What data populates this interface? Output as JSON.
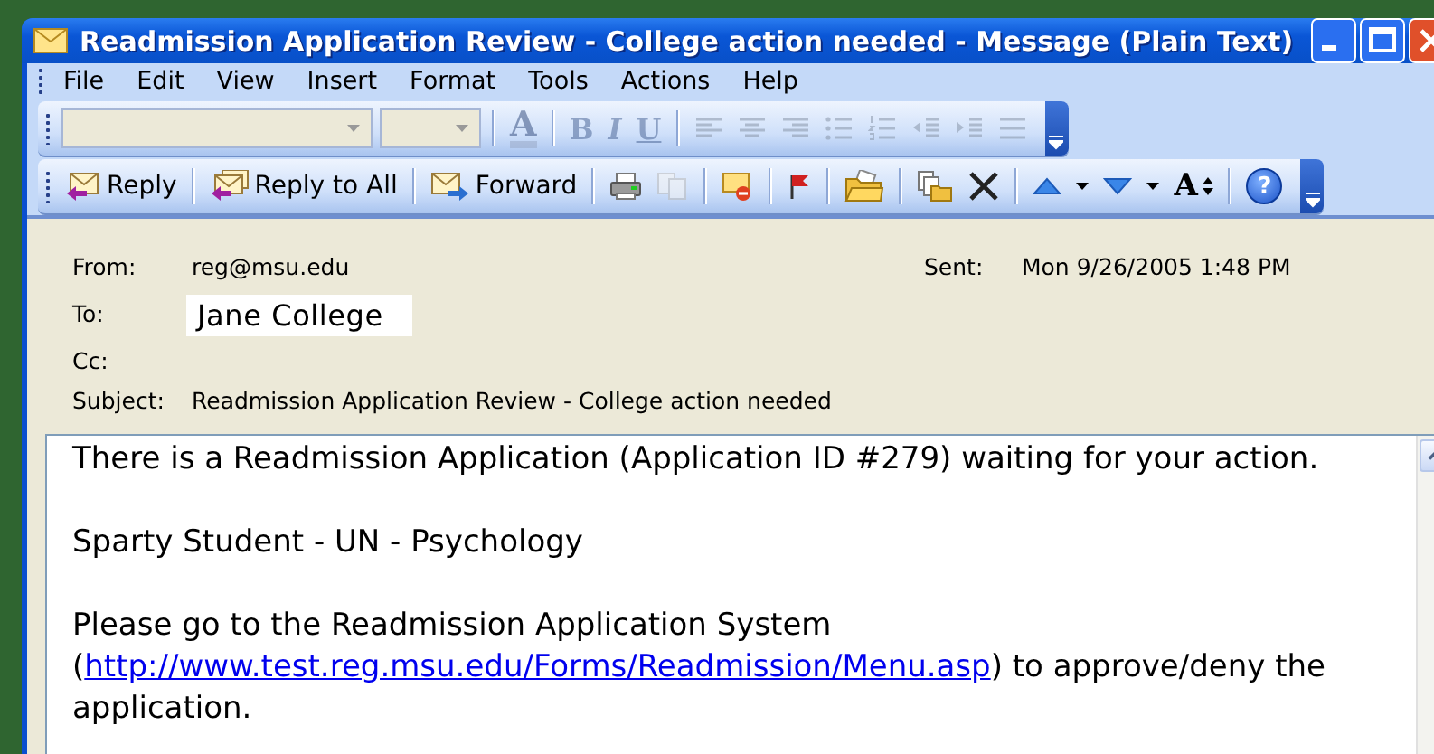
{
  "window": {
    "title": "Readmission Application Review - College action needed - Message (Plain Text)",
    "controls": [
      {
        "kind": "minimize"
      },
      {
        "kind": "maximize"
      },
      {
        "kind": "close"
      }
    ]
  },
  "menu": [
    "File",
    "Edit",
    "View",
    "Insert",
    "Format",
    "Tools",
    "Actions",
    "Help"
  ],
  "format_toolbar": {
    "disabled": true,
    "groups": [
      [
        {
          "kind": "font-combo"
        },
        {
          "kind": "size-combo"
        }
      ],
      [
        {
          "kind": "font-color",
          "label": "A"
        }
      ],
      [
        {
          "kind": "bold",
          "label": "B"
        },
        {
          "kind": "italic",
          "label": "I"
        },
        {
          "kind": "underline",
          "label": "U"
        }
      ],
      [
        {
          "kind": "align-left"
        },
        {
          "kind": "align-center"
        },
        {
          "kind": "align-right"
        },
        {
          "kind": "bullets"
        },
        {
          "kind": "numbering"
        },
        {
          "kind": "outdent"
        },
        {
          "kind": "indent"
        },
        {
          "kind": "line-style"
        }
      ]
    ]
  },
  "standard_toolbar": {
    "groups": [
      [
        {
          "kind": "reply",
          "label": "Reply",
          "disabled": false
        }
      ],
      [
        {
          "kind": "reply-all",
          "label": "Reply to All",
          "disabled": false
        }
      ],
      [
        {
          "kind": "forward",
          "label": "Forward",
          "disabled": false
        }
      ],
      [
        {
          "kind": "print",
          "disabled": false
        },
        {
          "kind": "copy",
          "disabled": true
        }
      ],
      [
        {
          "kind": "mark-unread",
          "disabled": false
        }
      ],
      [
        {
          "kind": "flag",
          "disabled": false
        }
      ],
      [
        {
          "kind": "move-folder",
          "disabled": false
        }
      ],
      [
        {
          "kind": "copy-folder",
          "disabled": false
        },
        {
          "kind": "delete",
          "disabled": false
        }
      ],
      [
        {
          "kind": "previous",
          "disabled": false
        },
        {
          "kind": "dropdown",
          "disabled": false
        },
        {
          "kind": "next",
          "disabled": false
        },
        {
          "kind": "dropdown",
          "disabled": false
        },
        {
          "kind": "font-size",
          "label": "A",
          "disabled": false
        }
      ],
      [
        {
          "kind": "help",
          "label": "?",
          "disabled": false
        }
      ]
    ]
  },
  "header": {
    "from_label": "From:",
    "from": "reg@msu.edu",
    "sent_label": "Sent:",
    "sent": "Mon 9/26/2005 1:48 PM",
    "to_label": "To:",
    "to": "Jane College",
    "cc_label": "Cc:",
    "subject_label": "Subject:",
    "subject": "Readmission Application Review - College action needed"
  },
  "body": {
    "paragraphs": [
      {
        "text": "There is a Readmission Application (Application ID #279) waiting for your action."
      },
      {
        "text": "Sparty Student - UN - Psychology"
      },
      {
        "text": "Please go to the Readmission Application System\n(",
        "link": "http://www.test.reg.msu.edu/Forms/Readmission/Menu.asp",
        "after": ") to approve/deny the application."
      }
    ]
  }
}
